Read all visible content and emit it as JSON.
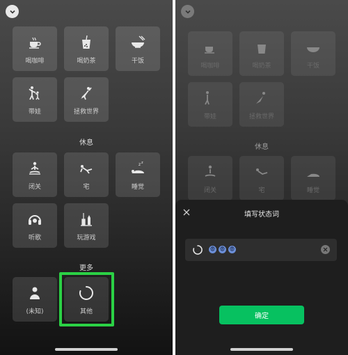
{
  "left": {
    "tiles_row1": [
      {
        "label": "喝咖啡",
        "icon": "coffee-cup-icon"
      },
      {
        "label": "喝奶茶",
        "icon": "milk-tea-icon"
      },
      {
        "label": "干饭",
        "icon": "rice-bowl-icon"
      }
    ],
    "tiles_row2": [
      {
        "label": "带娃",
        "icon": "parent-child-icon"
      },
      {
        "label": "拯救世界",
        "icon": "superhero-icon"
      }
    ],
    "section_rest": "休息",
    "tiles_row3": [
      {
        "label": "闭关",
        "icon": "meditation-icon"
      },
      {
        "label": "宅",
        "icon": "lounging-icon"
      },
      {
        "label": "睡觉",
        "icon": "sleep-icon"
      }
    ],
    "tiles_row4": [
      {
        "label": "听歌",
        "icon": "headphones-icon"
      },
      {
        "label": "玩游戏",
        "icon": "game-icon"
      }
    ],
    "section_more": "更多",
    "tiles_row5": [
      {
        "label": "(未知)",
        "icon": "person-icon"
      },
      {
        "label": "其他",
        "icon": "ring-icon"
      }
    ]
  },
  "right": {
    "sheet_title": "填写状态词",
    "input_emojis": [
      "😨",
      "😨",
      "😨"
    ],
    "confirm_label": "确定"
  },
  "colors": {
    "highlight": "#2bd145",
    "confirm": "#07c160"
  }
}
